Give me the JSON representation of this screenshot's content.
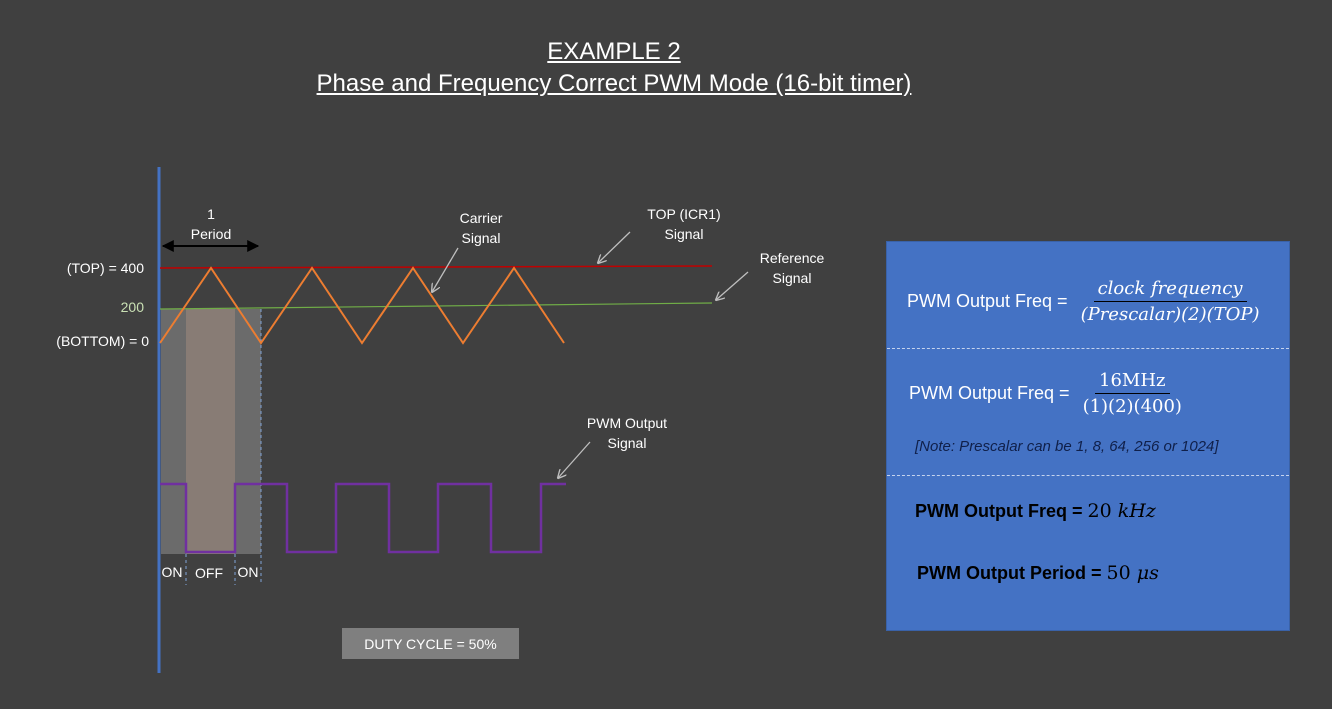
{
  "title": {
    "line1": "EXAMPLE 2",
    "line2": "Phase and Frequency Correct PWM Mode (16-bit timer)"
  },
  "diagram": {
    "period_label_1": "1",
    "period_label_2": "Period",
    "axis_top_label": "(TOP) = 400",
    "axis_mid_label": "200",
    "axis_bottom_label": "(BOTTOM) = 0",
    "carrier_label_1": "Carrier",
    "carrier_label_2": "Signal",
    "top_label_1": "TOP (ICR1)",
    "top_label_2": "Signal",
    "reference_label_1": "Reference",
    "reference_label_2": "Signal",
    "pwm_label_1": "PWM Output",
    "pwm_label_2": "Signal",
    "on_label": "ON",
    "off_label": "OFF",
    "on_label_2": "ON",
    "duty_cycle": "DUTY CYCLE = 50%",
    "colors": {
      "carrier": "#ed7d31",
      "top_line": "#c00000",
      "reference": "#70ad47",
      "pwm": "#7030a0",
      "axis": "#4472c4"
    }
  },
  "panel": {
    "eq1_label": "PWM Output Freq = ",
    "eq1_num": "clock frequency",
    "eq1_den": "(Prescalar)(2)(TOP)",
    "eq2_label": "PWM Output Freq = ",
    "eq2_num": "16MHz",
    "eq2_den": "(1)(2)(400)",
    "note": "[Note: Prescalar can be 1, 8, 64, 256 or 1024]",
    "result1_label": "PWM Output Freq = ",
    "result1_value": "20 ",
    "result1_unit": "kHz",
    "result2_label": "PWM Output Period = ",
    "result2_value": "50 ",
    "result2_unit": "μs",
    "color": "#4472c4"
  }
}
